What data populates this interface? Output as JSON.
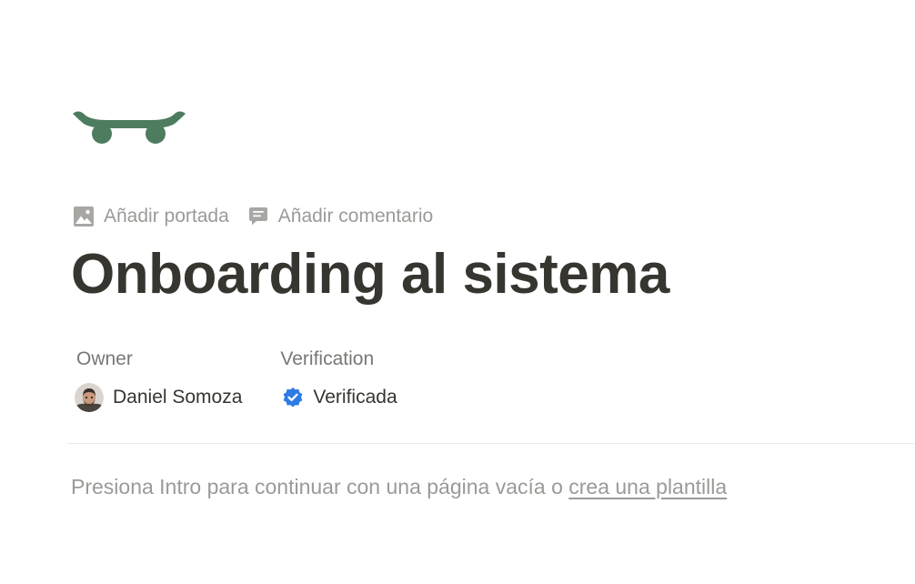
{
  "page": {
    "icon": "skateboard-icon",
    "title": "Onboarding al sistema",
    "controls": {
      "add_cover": "Añadir portada",
      "add_comment": "Añadir comentario"
    }
  },
  "properties": {
    "owner": {
      "name": "Owner",
      "value": "Daniel Somoza"
    },
    "verification": {
      "name": "Verification",
      "value": "Verificada"
    }
  },
  "empty_state": {
    "text": "Presiona Intro para continuar con una página vacía o ",
    "link": "crea una plantilla"
  },
  "colors": {
    "icon_green": "#4e7c5f",
    "verified_blue": "#2e7be4",
    "text": "#37352f",
    "muted": "#9b9a97"
  }
}
